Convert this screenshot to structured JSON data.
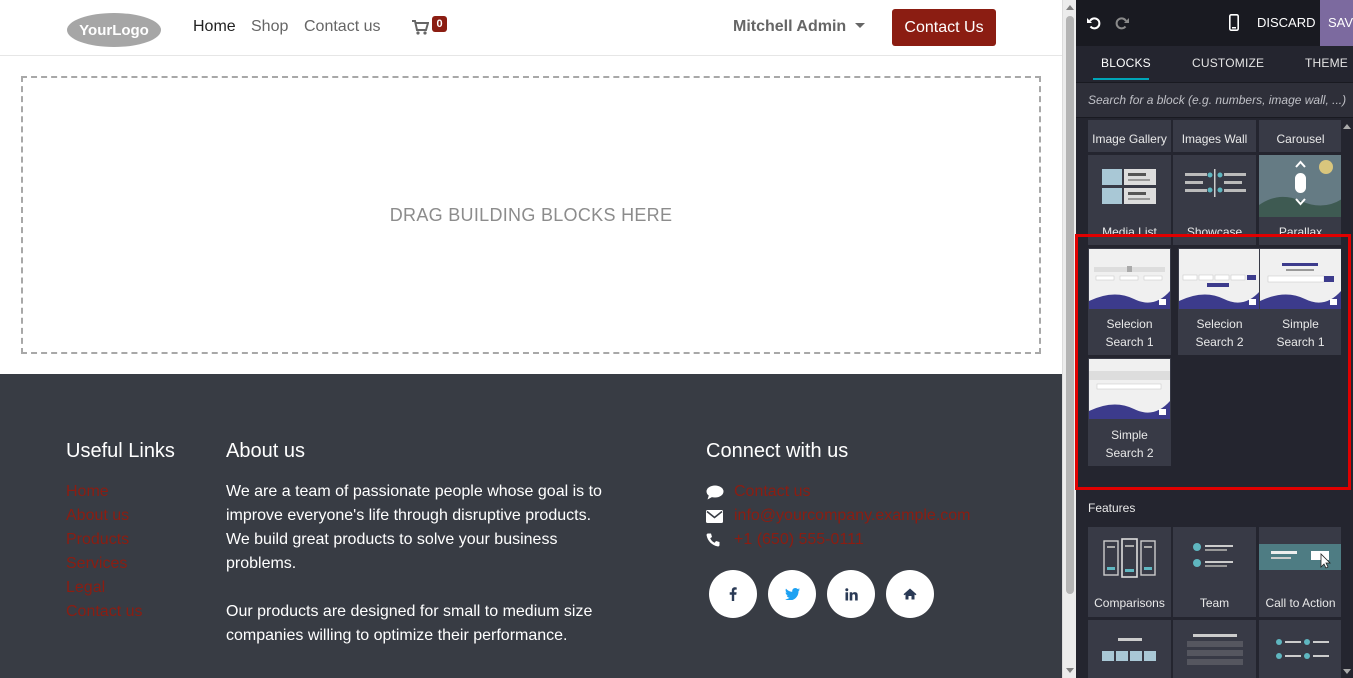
{
  "header": {
    "logo_text": "YourLogo",
    "nav": [
      "Home",
      "Shop",
      "Contact us"
    ],
    "cart_count": "0",
    "user_name": "Mitchell Admin",
    "cta_label": "Contact Us"
  },
  "dropzone_text": "DRAG BUILDING BLOCKS HERE",
  "footer": {
    "links_title": "Useful Links",
    "links": [
      "Home",
      "About us",
      "Products",
      "Services",
      "Legal",
      "Contact us"
    ],
    "about_title": "About us",
    "about_p1": "We are a team of passionate people whose goal is to improve everyone's life through disruptive products. We build great products to solve your business problems.",
    "about_p2": "Our products are designed for small to medium size companies willing to optimize their performance.",
    "connect_title": "Connect with us",
    "contact_items": [
      {
        "icon": "comment-icon",
        "text": "Contact us"
      },
      {
        "icon": "envelope-icon",
        "text": "info@yourcompany.example.com"
      },
      {
        "icon": "phone-icon",
        "text": "+1 (650) 555-0111"
      }
    ],
    "socials": [
      {
        "icon": "facebook-icon",
        "glyph": "f"
      },
      {
        "icon": "twitter-icon",
        "glyph": "t"
      },
      {
        "icon": "linkedin-icon",
        "glyph": "in"
      },
      {
        "icon": "home-icon",
        "glyph": "⌂"
      }
    ]
  },
  "editor": {
    "discard_label": "DISCARD",
    "save_label": "SAVE",
    "tabs": [
      "BLOCKS",
      "CUSTOMIZE",
      "THEME"
    ],
    "search_placeholder": "Search for a block (e.g. numbers, image wall, ...)",
    "blocks_row1": [
      "Image Gallery",
      "Images Wall",
      "Carousel"
    ],
    "blocks_row2": [
      "Media List",
      "Showcase",
      "Parallax"
    ],
    "search_blocks": [
      {
        "line1": "Selecion",
        "line2": "Search 1"
      },
      {
        "line1": "Selecion",
        "line2": "Search 2"
      },
      {
        "line1": "Simple",
        "line2": "Search 1"
      },
      {
        "line1": "Simple",
        "line2": "Search 2"
      }
    ],
    "features_title": "Features",
    "feature_blocks": [
      "Comparisons",
      "Team",
      "Call to Action"
    ]
  },
  "colors": {
    "brand": "#8b1d12",
    "footer_bg": "#383c44",
    "panel_bg": "#24252f",
    "highlight": "#e00000",
    "accent_tab": "#00a6b8"
  }
}
